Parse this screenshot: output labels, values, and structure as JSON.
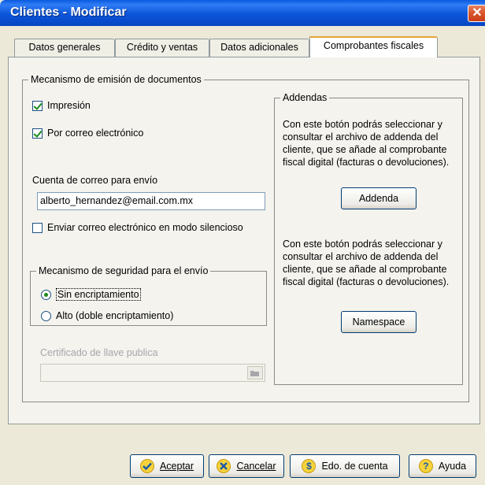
{
  "window": {
    "title": "Clientes - Modificar",
    "close_glyph": "✕"
  },
  "tabs": [
    {
      "label": "Datos generales"
    },
    {
      "label": "Crédito y ventas"
    },
    {
      "label": "Datos adicionales"
    },
    {
      "label": "Comprobantes fiscales"
    }
  ],
  "mecanismo": {
    "legend": "Mecanismo de emisión de documentos",
    "impresion": {
      "label": "Impresión",
      "checked": true
    },
    "correo": {
      "label": "Por correo electrónico",
      "checked": true
    },
    "cuenta_label": "Cuenta de correo para envío",
    "cuenta_value": "alberto_hernandez@email.com.mx",
    "silencioso": {
      "label": "Enviar correo electrónico en  modo silencioso",
      "checked": false
    }
  },
  "seguridad": {
    "legend": "Mecanismo de seguridad para el envío",
    "opt1": "Sin encriptamiento",
    "opt2": "Alto (doble encriptamiento)",
    "selected": "opt1"
  },
  "certificado": {
    "label": "Certificado de llave publica",
    "value": ""
  },
  "addendas": {
    "legend": "Addendas",
    "text1": "Con este botón podrás seleccionar y consultar el archivo de addenda del cliente, que se añade al comprobante fiscal digital (facturas o devoluciones).",
    "button1": "Addenda",
    "text2": "Con este botón podrás seleccionar y consultar el archivo de addenda del cliente, que se añade al comprobante fiscal digital (facturas o devoluciones).",
    "button2": "Namespace"
  },
  "footer": {
    "aceptar": "Aceptar",
    "cancelar": "Cancelar",
    "edo_cuenta": "Edo. de cuenta",
    "ayuda": "Ayuda"
  },
  "colors": {
    "title_bar": "#0b55d9",
    "accent_tab": "#e6a33c",
    "window_bg": "#ece9d8"
  },
  "icons": {
    "aceptar": "check-circle-icon",
    "cancelar": "x-circle-icon",
    "edo_cuenta": "dollar-icon",
    "ayuda": "question-icon"
  }
}
